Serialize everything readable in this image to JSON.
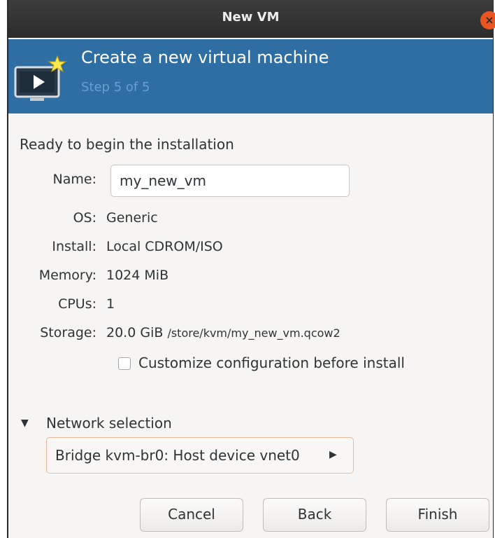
{
  "window": {
    "title": "New VM",
    "close_glyph": "×"
  },
  "banner": {
    "heading": "Create a new virtual machine",
    "step": "Step 5 of 5",
    "icon": "monitor-play-icon"
  },
  "summary": {
    "title": "Ready to begin the installation",
    "name_label": "Name:",
    "name_value": "my_new_vm",
    "os_label": "OS:",
    "os_value": "Generic",
    "install_label": "Install:",
    "install_value": "Local CDROM/ISO",
    "memory_label": "Memory:",
    "memory_value": "1024 MiB",
    "cpus_label": "CPUs:",
    "cpus_value": "1",
    "storage_label": "Storage:",
    "storage_size": "20.0 GiB",
    "storage_path": "/store/kvm/my_new_vm.qcow2",
    "customize_label": "Customize configuration before install",
    "customize_checked": false
  },
  "network": {
    "arrow": "▼",
    "label": "Network selection",
    "selected": "Bridge kvm-br0: Host device vnet0",
    "combo_arrow": "▶"
  },
  "buttons": {
    "cancel": "Cancel",
    "back": "Back",
    "finish": "Finish"
  },
  "colors": {
    "banner": "#2f6ea3",
    "titlebar": "#2c2c2c",
    "close": "#e95420",
    "step_text": "#6b9fd0"
  }
}
